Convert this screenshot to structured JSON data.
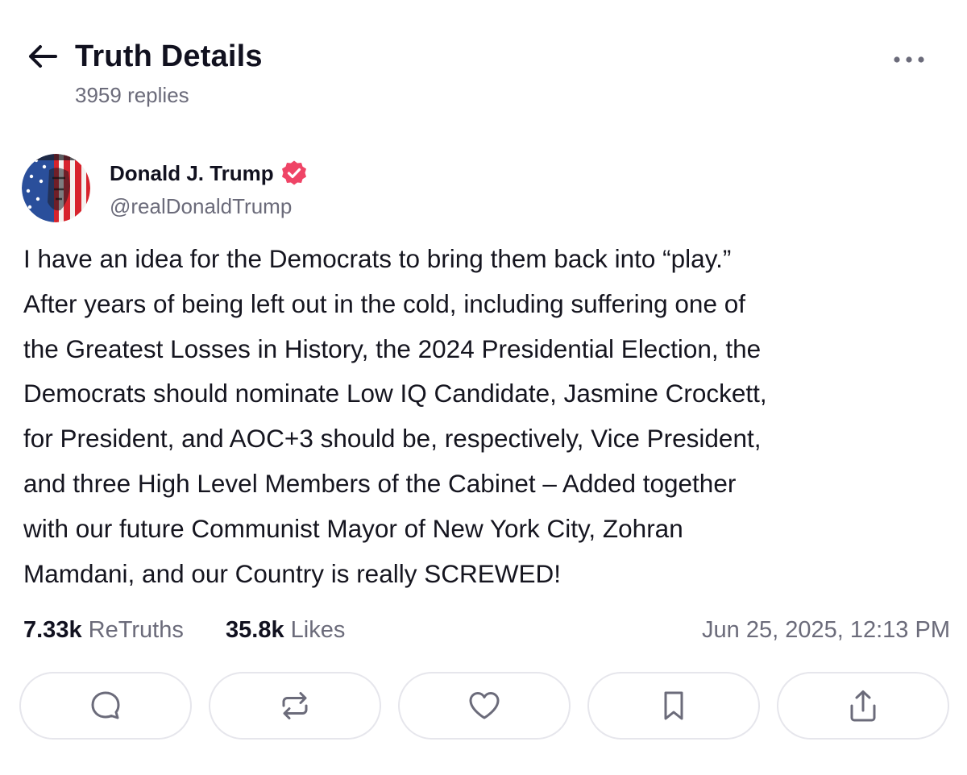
{
  "header": {
    "title": "Truth Details",
    "replies": "3959 replies"
  },
  "author": {
    "name": "Donald J. Trump",
    "handle": "@realDonaldTrump",
    "verified": true
  },
  "post": {
    "lines": [
      "I have an idea for the Democrats to bring them back into “play.”",
      "After years of being left out in the cold, including suffering one of",
      "the Greatest Losses in History, the 2024 Presidential Election, the",
      "Democrats should nominate Low IQ Candidate, Jasmine Crockett,",
      "for President, and AOC+3 should be, respectively, Vice President,",
      "and three High Level Members of the Cabinet – Added together",
      "with our future Communist Mayor of New York City, Zohran",
      "Mamdani, and our Country is really SCREWED!"
    ]
  },
  "stats": {
    "retruths_count": "7.33k",
    "retruths_label": "ReTruths",
    "likes_count": "35.8k",
    "likes_label": "Likes",
    "timestamp": "Jun 25, 2025, 12:13 PM"
  },
  "actions": {
    "icons": [
      "reply-icon",
      "retruth-icon",
      "like-icon",
      "bookmark-icon",
      "share-icon"
    ]
  },
  "colors": {
    "text_primary": "#11111f",
    "text_secondary": "#6b6b7a",
    "verified_badge": "#ef4466",
    "icon_gray": "#6b6b7a",
    "button_border": "#e6e6ec"
  }
}
